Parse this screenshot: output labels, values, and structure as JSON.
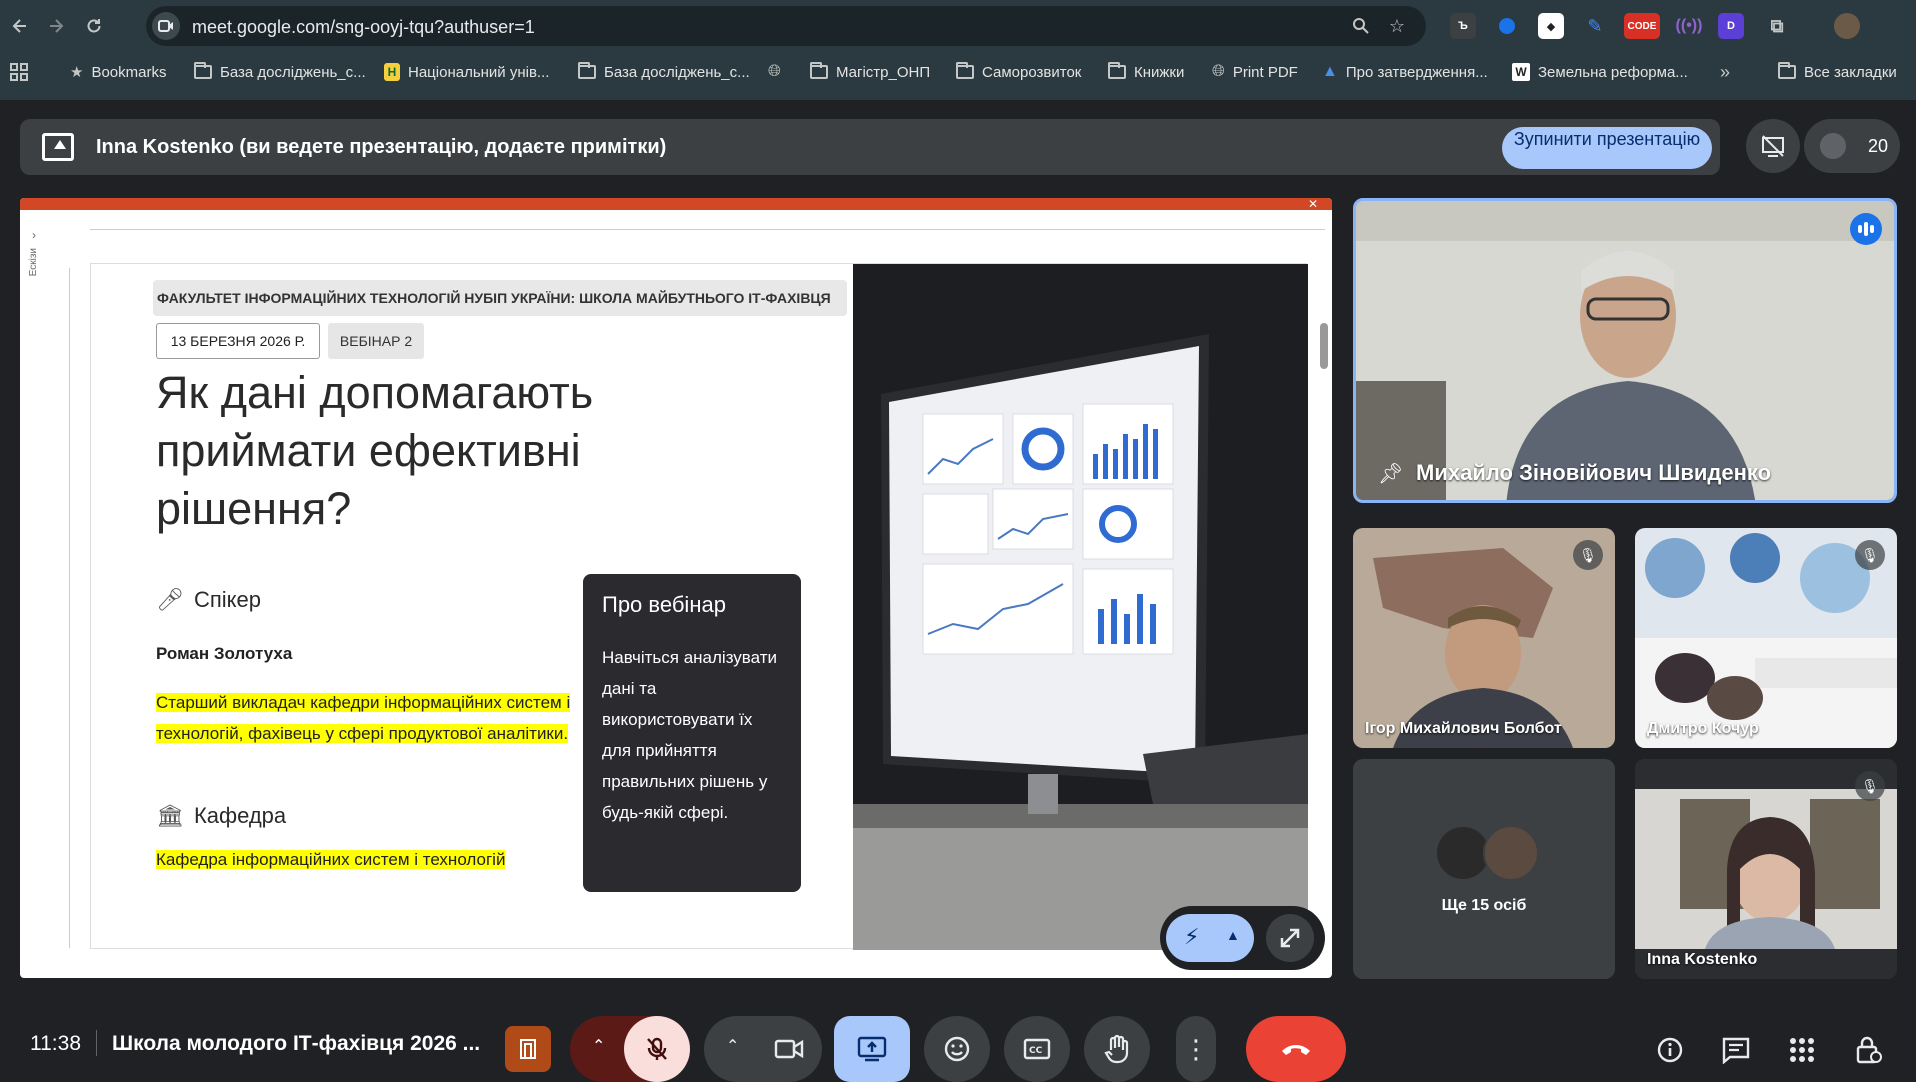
{
  "browser": {
    "url": "meet.google.com/sng-ooyj-tqu?authuser=1",
    "extensions": [
      "translate-ext-icon",
      "blue-dot-ext-icon",
      "cube-ext-icon",
      "tag-ext-icon",
      "code-ext-icon",
      "radio-ext-icon",
      "d-ext-icon",
      "puzzle-ext-icon",
      "profile-avatar"
    ],
    "code_ext_label": "CODE",
    "bookmarks": [
      {
        "label": "Bookmarks",
        "icon": "star-icon"
      },
      {
        "label": "База досліджень_с...",
        "icon": "folder-icon"
      },
      {
        "label": "Національний унів...",
        "icon": "university-icon"
      },
      {
        "label": "База досліджень_с...",
        "icon": "folder-icon"
      },
      {
        "label": "",
        "icon": "globe-icon"
      },
      {
        "label": "Магістр_ОНП",
        "icon": "folder-icon"
      },
      {
        "label": "Саморозвиток",
        "icon": "folder-icon"
      },
      {
        "label": "Книжки",
        "icon": "folder-icon"
      },
      {
        "label": "Print PDF",
        "icon": "globe-icon"
      },
      {
        "label": "Про затвердження...",
        "icon": "gov-icon"
      },
      {
        "label": "Земельна реформа...",
        "icon": "wiki-icon"
      }
    ],
    "all_bookmarks": "Все закладки"
  },
  "presenting": {
    "text": "Inna Kostenko (ви ведете презентацію, додаєте примітки)",
    "stop_label": "Зупинити презентацію",
    "people_count": "20"
  },
  "slide": {
    "faculty": "ФАКУЛЬТЕТ ІНФОРМАЦІЙНИХ ТЕХНОЛОГІЙ НУБІП УКРАЇНИ: ШКОЛА МАЙБУТНЬОГО ІТ-ФАХІВЦЯ",
    "date": "13 БЕРЕЗНЯ 2026 Р.",
    "webinar": "ВЕБІНАР 2",
    "title_lines": [
      "Як дані допомагають",
      "приймати ефективні",
      "рішення?"
    ],
    "speaker_heading": "Спікер",
    "speaker_name": "Роман Золотуха",
    "speaker_desc": "Старший викладач кафедри інформаційних систем і технологій, фахівець у сфері продуктової аналітики.",
    "dept_heading": "Кафедра",
    "dept_name": "Кафедра інформаційних систем і технологій",
    "about_title": "Про вебінар",
    "about_text": "Навчіться аналізувати дані та використовувати їх для прийняття правильних рішень у будь-якій сфері.",
    "thumbnails_tab": "Ескізи"
  },
  "participants": {
    "main": {
      "name": "Михайло Зіновійович Швиденко",
      "speaking": true
    },
    "tiles": [
      {
        "name": "Ігор Михайлович Болбот",
        "muted": true
      },
      {
        "name": "Дмитро Кочур",
        "muted": true
      },
      {
        "name": "Inna Kostenko",
        "muted": true
      }
    ],
    "more": "Ще 15 осіб"
  },
  "bottom": {
    "time": "11:38",
    "meeting_title": "Школа молодого ІТ-фахівця 2026 ..."
  }
}
